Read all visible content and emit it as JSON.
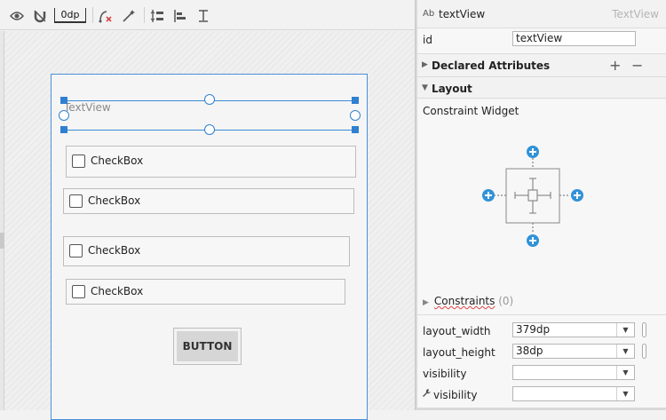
{
  "toolbar": {
    "default_margin": "0dp",
    "icons": [
      "eye-icon",
      "magnet-off-icon",
      "clear-constraints-icon",
      "infer-constraints-icon",
      "pack-icon",
      "align-icon",
      "guidelines-icon"
    ]
  },
  "canvas": {
    "textview_text": "TextView",
    "checkboxes": [
      "CheckBox",
      "CheckBox",
      "CheckBox",
      "CheckBox"
    ],
    "button_label": "BUTTON"
  },
  "panel": {
    "ab_icon_text": "Ab",
    "title": "textView",
    "type_label": "TextView",
    "id_label": "id",
    "id_value": "textView",
    "declared_attributes": "Declared Attributes",
    "layout_section": "Layout",
    "constraint_widget": "Constraint Widget",
    "constraints_label": "Constraints",
    "constraints_count": "(0)",
    "props": [
      {
        "label": "layout_width",
        "value": "379dp"
      },
      {
        "label": "layout_height",
        "value": "38dp"
      },
      {
        "label": "visibility",
        "value": ""
      },
      {
        "label": "visibility",
        "value": ""
      }
    ]
  },
  "colors": {
    "accent": "#2f80d1",
    "constraint_plus": "#3192d8"
  }
}
